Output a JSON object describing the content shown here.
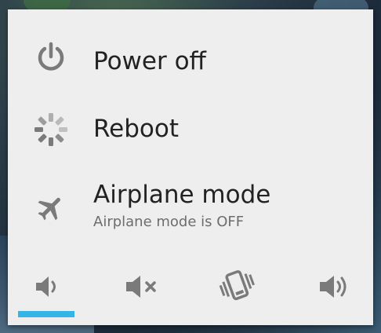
{
  "dialog": {
    "items": [
      {
        "label": "Power off",
        "icon": "power-icon"
      },
      {
        "label": "Reboot",
        "icon": "reboot-icon"
      },
      {
        "label": "Airplane mode",
        "sublabel": "Airplane mode is OFF",
        "icon": "airplane-icon"
      }
    ],
    "sound_modes": [
      {
        "icon": "volume-low-icon",
        "selected": true
      },
      {
        "icon": "volume-mute-icon",
        "selected": false
      },
      {
        "icon": "vibrate-icon",
        "selected": false
      },
      {
        "icon": "volume-high-icon",
        "selected": false
      }
    ]
  },
  "colors": {
    "dialog_bg": "#eeeeee",
    "icon_gray": "#7a7a7a",
    "label_text": "#222222",
    "sublabel_text": "#6d6d6d",
    "selected_indicator": "#33b5e5"
  }
}
